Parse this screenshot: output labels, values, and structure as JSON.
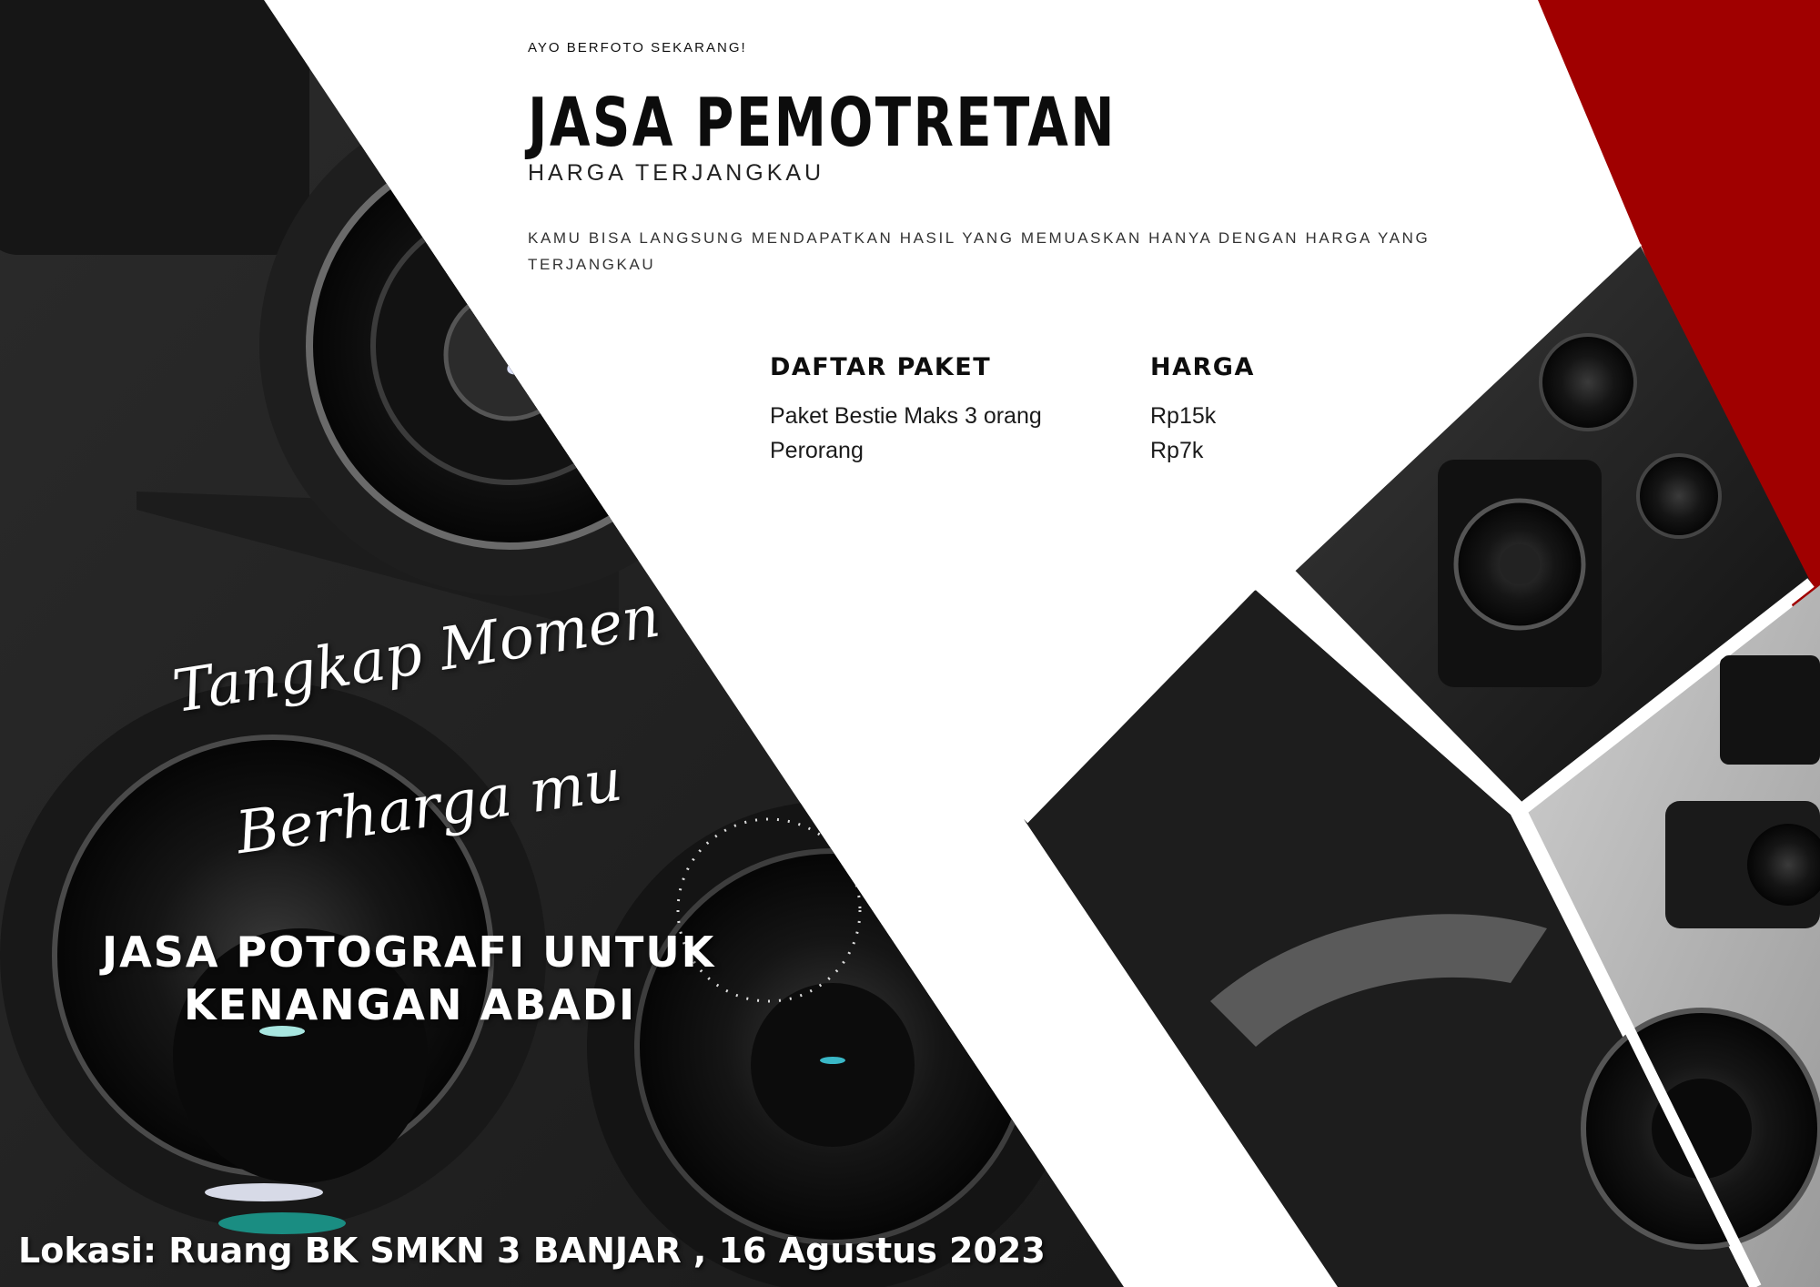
{
  "header": {
    "eyebrow": "AYO BERFOTO SEKARANG!",
    "title": "JASA PEMOTRETAN",
    "subtitle": "HARGA TERJANGKAU",
    "description": "KAMU BISA LANGSUNG MENDAPATKAN HASIL YANG MEMUASKAN HANYA DENGAN HARGA YANG TERJANGKAU"
  },
  "packages": {
    "col_package_header": "DAFTAR PAKET",
    "col_price_header": "HARGA",
    "items": [
      {
        "name": "Paket Bestie Maks 3 orang",
        "price": "Rp15k"
      },
      {
        "name": "Perorang",
        "price": "Rp7k"
      }
    ]
  },
  "promo": {
    "script_line1": "Tangkap Momen",
    "script_line2": "Berharga mu",
    "heading_line1": "JASA POTOGRAFI  UNTUK",
    "heading_line2": "KENANGAN ABADI"
  },
  "footer": {
    "location_text": "Lokasi: Ruang BK SMKN 3 BANJAR , 16 Agustus 2023"
  },
  "colors": {
    "accent_red": "#a00000",
    "dark_panel": "#262626",
    "background": "#ffffff"
  }
}
